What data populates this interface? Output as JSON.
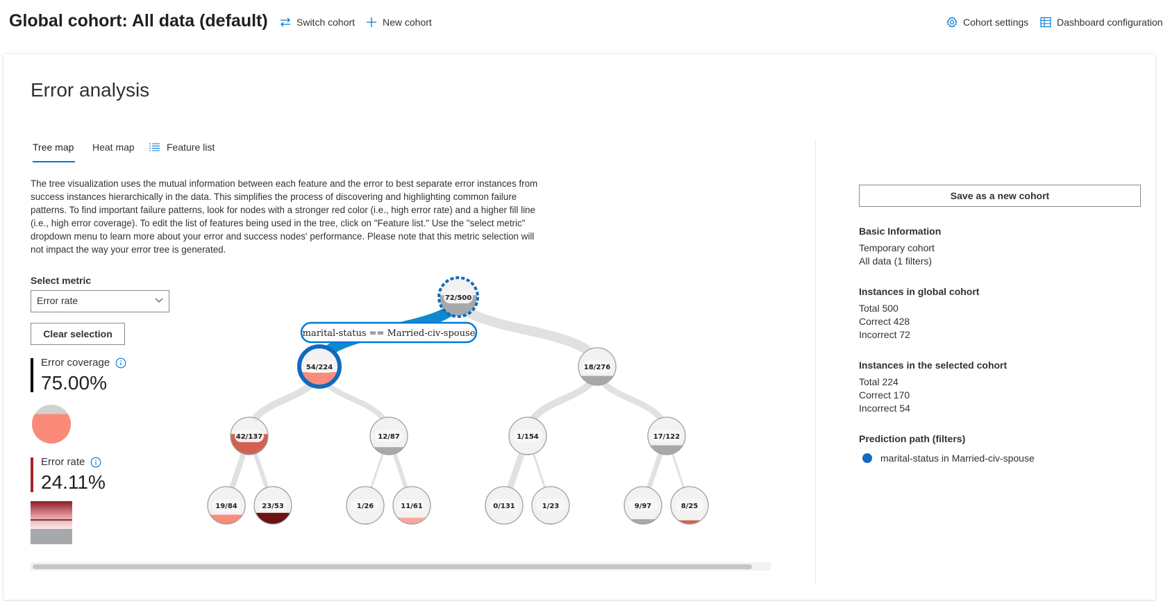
{
  "header": {
    "title": "Global cohort: All data (default)",
    "switch_cohort": "Switch cohort",
    "new_cohort": "New cohort",
    "cohort_settings": "Cohort settings",
    "dashboard_configuration": "Dashboard configuration"
  },
  "panel": {
    "title": "Error analysis",
    "tabs": [
      {
        "label": "Tree map",
        "active": true
      },
      {
        "label": "Heat map",
        "active": false
      },
      {
        "label": "Feature list",
        "active": false,
        "icon": "list-icon"
      }
    ],
    "description": "The tree visualization uses the mutual information between each feature and the error to best separate error instances from success instances hierarchically in the data. This simplifies the process of discovering and highlighting common failure patterns. To find important failure patterns, look for nodes with a stronger red color (i.e., high error rate) and a higher fill line (i.e., high error coverage). To edit the list of features being used in the tree, click on \"Feature list.\" Use the \"select metric\" dropdown menu to learn more about your error and success nodes' performance. Please note that this metric selection will not impact the way your error tree is generated.",
    "select_metric_label": "Select metric",
    "select_metric_value": "Error rate",
    "clear_selection": "Clear selection",
    "error_coverage_label": "Error coverage",
    "error_coverage_value": "75.00%",
    "error_coverage_fraction": 0.75,
    "error_rate_label": "Error rate",
    "error_rate_value": "24.11%",
    "colors": {
      "accent": "#0078d4",
      "coverage_bar": "#000000",
      "error_bar": "#a4262c",
      "node_fill": "#fa8b7a",
      "node_gray": "#a6a8ac"
    }
  },
  "tree": {
    "nodes": [
      {
        "id": "root",
        "label": "72/500",
        "fill": "#a6a8ac",
        "fill_level": 0.55,
        "state": "dashed-selected"
      },
      {
        "id": "l1",
        "label": "54/224",
        "fill": "#fa8b7a",
        "fill_level": 0.35,
        "state": "selected"
      },
      {
        "id": "r1",
        "label": "18/276",
        "fill": "#a6a8ac",
        "fill_level": 0.25,
        "state": "normal"
      },
      {
        "id": "l1a",
        "label": "42/137",
        "fill": "#d2614f",
        "fill_level": 0.55,
        "state": "normal"
      },
      {
        "id": "l1b",
        "label": "12/87",
        "fill": "#a6a8ac",
        "fill_level": 0.2,
        "state": "normal"
      },
      {
        "id": "r1a",
        "label": "1/154",
        "fill": "#a6a8ac",
        "fill_level": 0.02,
        "state": "normal"
      },
      {
        "id": "r1b",
        "label": "17/122",
        "fill": "#a6a8ac",
        "fill_level": 0.25,
        "state": "normal"
      },
      {
        "id": "n1",
        "label": "19/84",
        "fill": "#fa8b7a",
        "fill_level": 0.25,
        "state": "normal"
      },
      {
        "id": "n2",
        "label": "23/53",
        "fill": "#6b1212",
        "fill_level": 0.3,
        "state": "normal"
      },
      {
        "id": "n3",
        "label": "1/26",
        "fill": "#a6a8ac",
        "fill_level": 0.02,
        "state": "normal"
      },
      {
        "id": "n4",
        "label": "11/61",
        "fill": "#f8a99d",
        "fill_level": 0.17,
        "state": "normal"
      },
      {
        "id": "n5",
        "label": "0/131",
        "fill": "#a6a8ac",
        "fill_level": 0.0,
        "state": "normal"
      },
      {
        "id": "n6",
        "label": "1/23",
        "fill": "#a6a8ac",
        "fill_level": 0.02,
        "state": "normal"
      },
      {
        "id": "n7",
        "label": "9/97",
        "fill": "#a6a8ac",
        "fill_level": 0.13,
        "state": "normal"
      },
      {
        "id": "n8",
        "label": "8/25",
        "fill": "#d2614f",
        "fill_level": 0.1,
        "state": "normal"
      }
    ],
    "path_label": "marital-status == Married-civ-spouse"
  },
  "side": {
    "save_button": "Save as a new cohort",
    "basic_info_title": "Basic Information",
    "basic_info_lines": [
      "Temporary cohort",
      "All data (1 filters)"
    ],
    "global_title": "Instances in global cohort",
    "global_lines": [
      "Total 500",
      "Correct 428",
      "Incorrect 72"
    ],
    "selected_title": "Instances in the selected cohort",
    "selected_lines": [
      "Total 224",
      "Correct 170",
      "Incorrect 54"
    ],
    "path_title": "Prediction path (filters)",
    "path_filter": "marital-status in Married-civ-spouse"
  }
}
